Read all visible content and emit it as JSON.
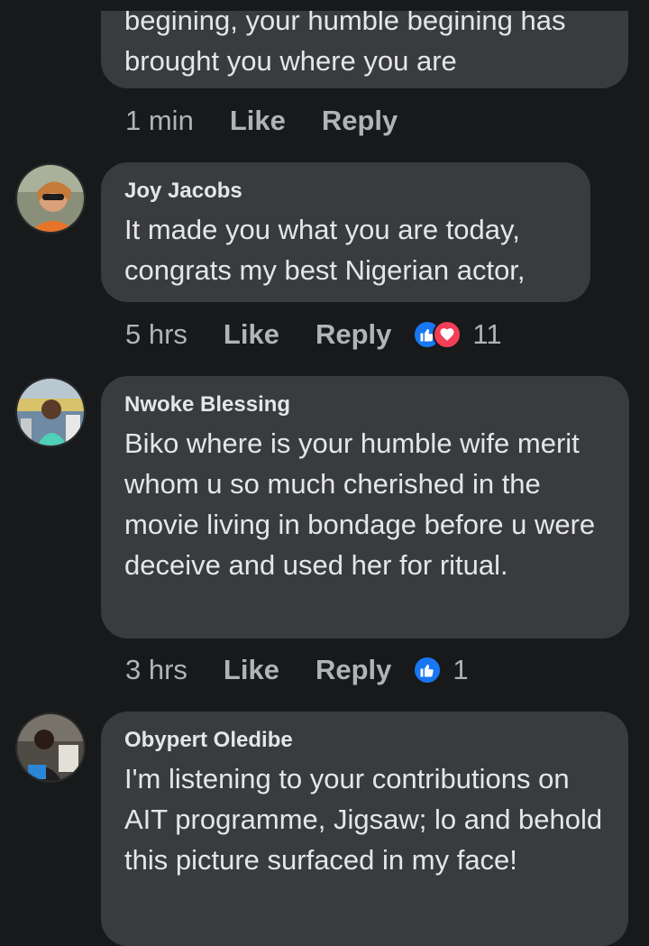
{
  "comments": [
    {
      "author": "",
      "text": "begining, your humble begining has brought you where you are",
      "time": "1 min",
      "like": "Like",
      "reply": "Reply",
      "reaction_count": ""
    },
    {
      "author": "Joy Jacobs",
      "text": "It made you what you are today, congrats my best Nigerian actor,",
      "time": "5 hrs",
      "like": "Like",
      "reply": "Reply",
      "reaction_count": "11",
      "reactions": [
        "like-icon",
        "love-icon"
      ]
    },
    {
      "author": "Nwoke Blessing",
      "text": "Biko where is your humble wife merit whom u so much cherished in the movie living in bondage before u were deceive and used her for ritual.",
      "time": "3 hrs",
      "like": "Like",
      "reply": "Reply",
      "reaction_count": "1",
      "reactions": [
        "like-icon"
      ]
    },
    {
      "author": "Obypert Oledibe",
      "text": "I'm listening to your contributions on AIT programme, Jigsaw; lo and behold this picture surfaced in my face!",
      "time": "",
      "like": "",
      "reply": "",
      "reaction_count": ""
    }
  ],
  "colors": {
    "background": "#18191a",
    "bubble": "#3a3b3c",
    "text": "#e4e6eb",
    "meta": "#b0b3b8",
    "like": "#1877f2",
    "love": "#f33e58"
  }
}
